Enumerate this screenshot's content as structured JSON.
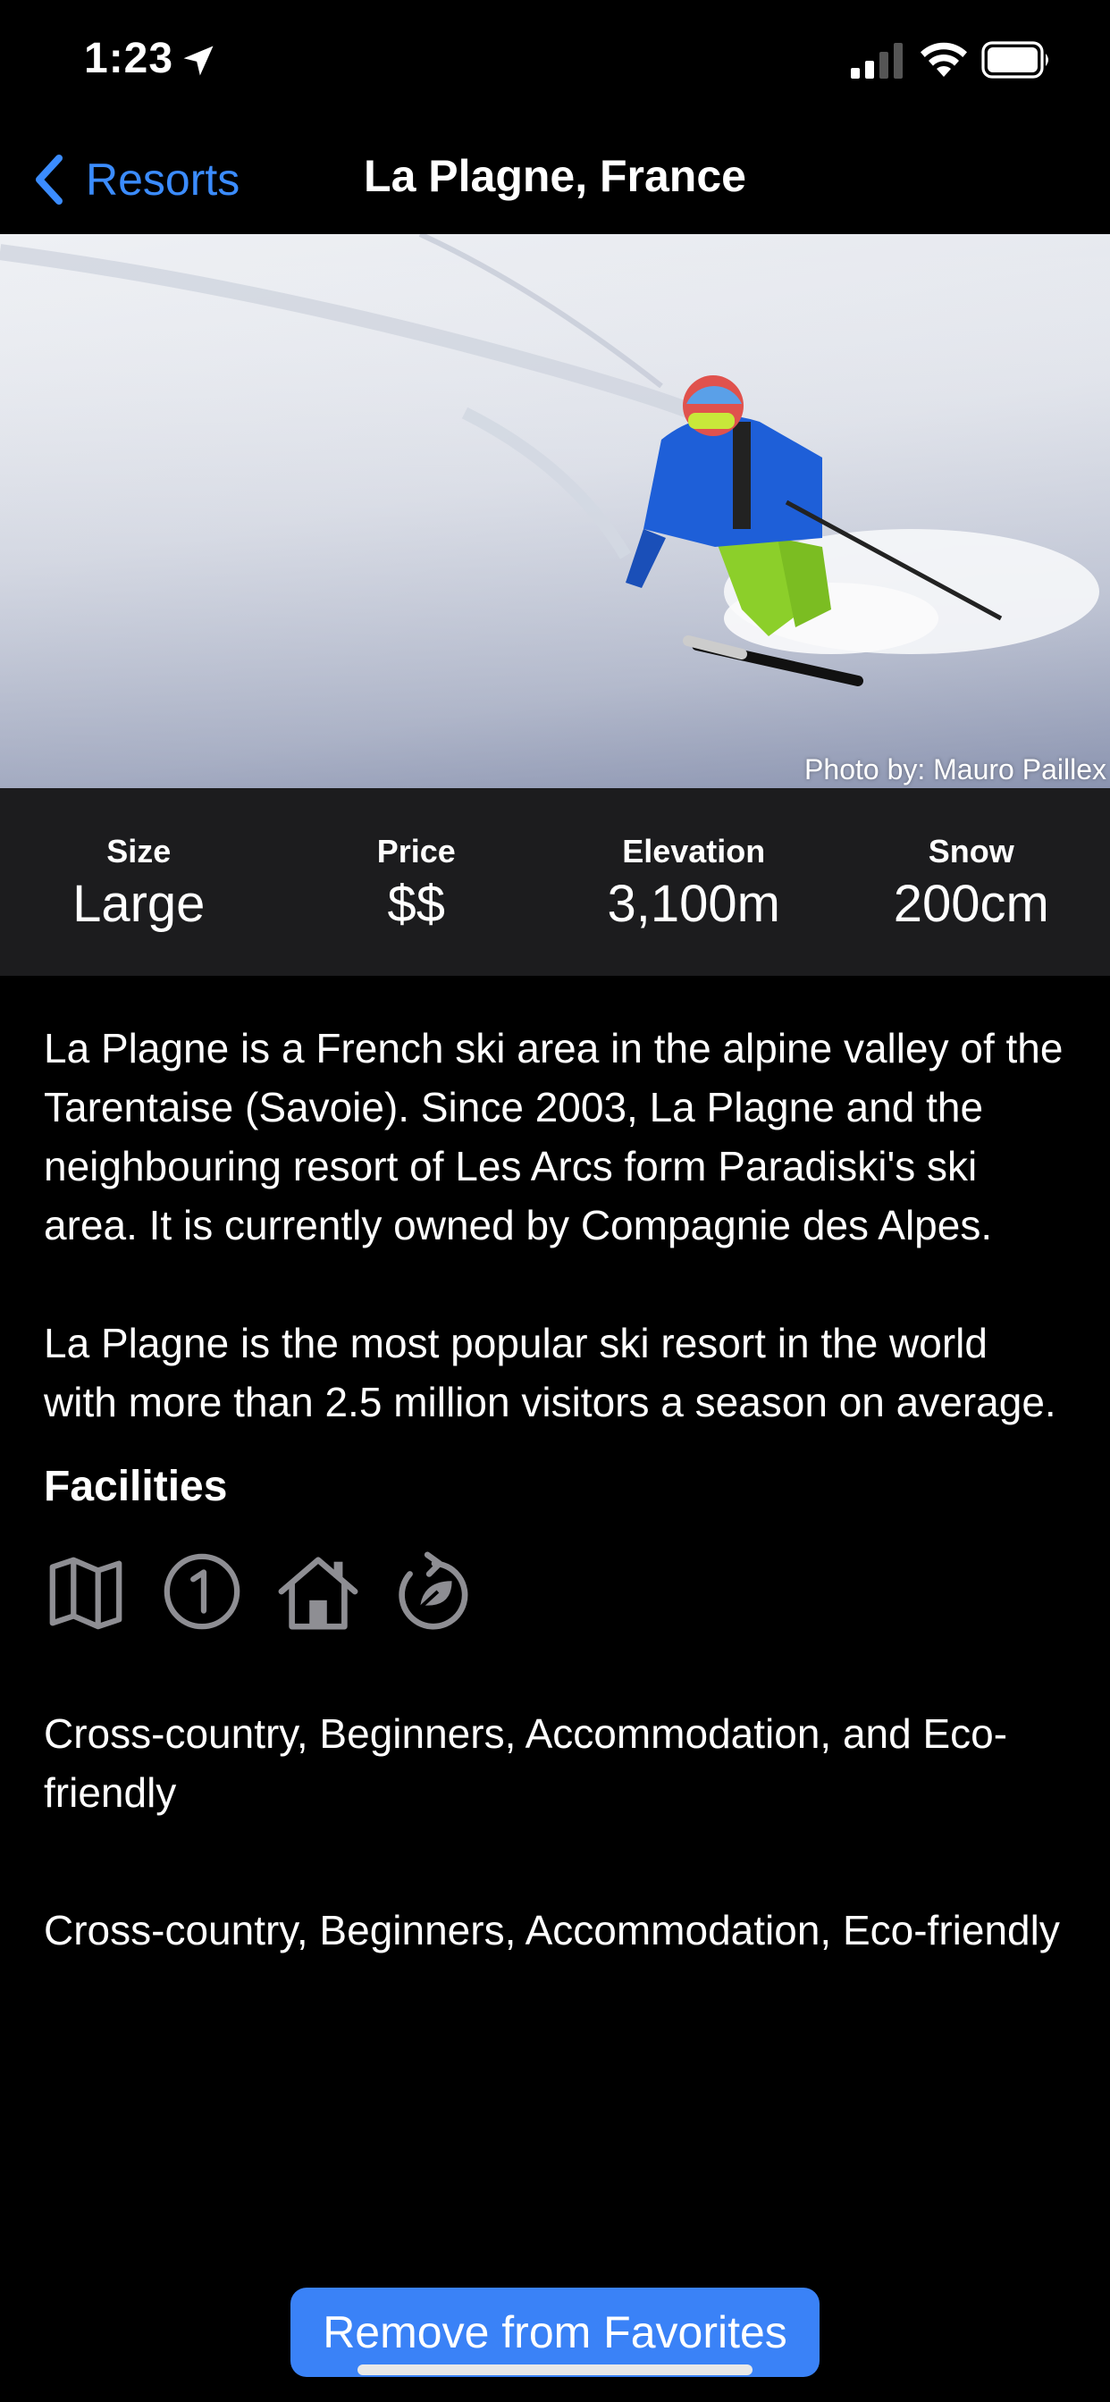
{
  "status_bar": {
    "time": "1:23"
  },
  "nav": {
    "back_label": "Resorts",
    "title": "La Plagne, France"
  },
  "hero": {
    "photo_credit": "Photo by: Mauro Paillex"
  },
  "stats": [
    {
      "label": "Size",
      "value": "Large"
    },
    {
      "label": "Price",
      "value": "$$"
    },
    {
      "label": "Elevation",
      "value": "3,100m"
    },
    {
      "label": "Snow",
      "value": "200cm"
    }
  ],
  "description": [
    "La Plagne is a French ski area in the alpine valley of the Tarentaise (Savoie). Since 2003, La Plagne and the neighbouring resort of Les Arcs form Paradiski's ski area. It is currently owned by Compagnie des Alpes.",
    "La Plagne is the most popular ski resort in the world with more than 2.5 million visitors a season on average."
  ],
  "facilities": {
    "heading": "Facilities",
    "icons": [
      "map-icon",
      "number-one-icon",
      "house-icon",
      "eco-leaf-icon"
    ],
    "list_joined": "Cross-country, Beginners, Accommodation, and Eco-friendly",
    "list_comma": "Cross-country, Beginners, Accommodation, Eco-friendly"
  },
  "actions": {
    "remove_label": "Remove from Favorites"
  },
  "colors": {
    "accent": "#3a82f7",
    "link": "#3b8cff",
    "stats_bg": "#1c1c1e",
    "icon_gray": "#8e8e93"
  }
}
